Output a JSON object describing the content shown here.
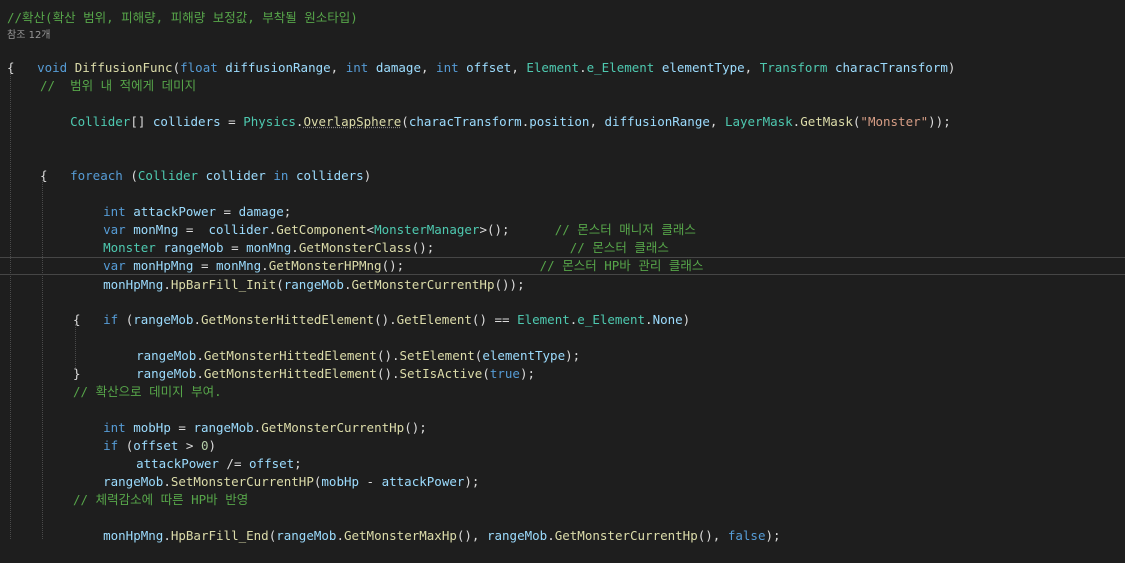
{
  "editor": {
    "header_comment": "//확산(확산 범위, 피해량, 피해량 보정값, 부착될 원소타입)",
    "references": "참조 12개",
    "lines": {
      "l1": [
        "void",
        " ",
        "DiffusionFunc",
        "(",
        "float",
        " ",
        "diffusionRange",
        ", ",
        "int",
        " ",
        "damage",
        ", ",
        "int",
        " ",
        "offset",
        ", ",
        "Element",
        ".",
        "e_Element",
        " ",
        "elementType",
        ", ",
        "Transform",
        " ",
        "characTransform",
        ")"
      ],
      "l2": [
        "{"
      ],
      "l3": [
        "//  범위 내 적에게 데미지"
      ],
      "l4": [
        "Collider",
        "[] ",
        "colliders",
        " = ",
        "Physics",
        ".",
        "OverlapSphere",
        "(",
        "characTransform",
        ".",
        "position",
        ", ",
        "diffusionRange",
        ", ",
        "LayerMask",
        ".",
        "GetMask",
        "(",
        "\"Monster\"",
        "));"
      ],
      "l7": [
        "foreach",
        " (",
        "Collider",
        " ",
        "collider",
        " ",
        "in",
        " ",
        "colliders",
        ")"
      ],
      "l8": [
        "{"
      ],
      "l9": [
        "int",
        " ",
        "attackPower",
        " = ",
        "damage",
        ";"
      ],
      "l10": [
        "var",
        " ",
        "monMng",
        " =  ",
        "collider",
        ".",
        "GetComponent",
        "<",
        "MonsterManager",
        ">();      ",
        "// 몬스터 매니저 클래스"
      ],
      "l11": [
        "Monster",
        " ",
        "rangeMob",
        " = ",
        "monMng",
        ".",
        "GetMonsterClass",
        "();                  ",
        "// 몬스터 클래스"
      ],
      "l12": [
        "var",
        " ",
        "monHpMng",
        " = ",
        "monMng",
        ".",
        "GetMonsterHPMng",
        "();                  ",
        "// 몬스터 HP바 관리 클래스"
      ],
      "l13": [
        "monHpMng",
        ".",
        "HpBarFill_Init",
        "(",
        "rangeMob",
        ".",
        "GetMonsterCurrentHp",
        "());"
      ],
      "l15": [
        "if",
        " (",
        "rangeMob",
        ".",
        "GetMonsterHittedElement",
        "().",
        "GetElement",
        "() == ",
        "Element",
        ".",
        "e_Element",
        ".",
        "None",
        ")"
      ],
      "l16": [
        "{"
      ],
      "l17": [
        "rangeMob",
        ".",
        "GetMonsterHittedElement",
        "().",
        "SetElement",
        "(",
        "elementType",
        ");"
      ],
      "l18": [
        "rangeMob",
        ".",
        "GetMonsterHittedElement",
        "().",
        "SetIsActive",
        "(",
        "true",
        ");"
      ],
      "l19": [
        "}"
      ],
      "l20": [
        "// 확산으로 데미지 부여."
      ],
      "l21": [
        "int",
        " ",
        "mobHp",
        " = ",
        "rangeMob",
        ".",
        "GetMonsterCurrentHp",
        "();"
      ],
      "l22": [
        "if",
        " (",
        "offset",
        " > ",
        "0",
        ")"
      ],
      "l23": [
        "attackPower",
        " /= ",
        "offset",
        ";"
      ],
      "l24": [
        "rangeMob",
        ".",
        "SetMonsterCurrentHP",
        "(",
        "mobHp",
        " - ",
        "attackPower",
        ");"
      ],
      "l26": [
        "// 체력감소에 따른 HP바 반영"
      ],
      "l27": [
        "monHpMng",
        ".",
        "HpBarFill_End",
        "(",
        "rangeMob",
        ".",
        "GetMonsterMaxHp",
        "(), ",
        "rangeMob",
        ".",
        "GetMonsterCurrentHp",
        "(), ",
        "false",
        ");"
      ]
    }
  },
  "colors": {
    "background": "#1e1e1e",
    "keyword": "#569cd6",
    "type": "#4ec9b0",
    "method": "#dcdcaa",
    "identifier": "#9cdcfe",
    "comment": "#57a64a",
    "string": "#d69d85"
  }
}
